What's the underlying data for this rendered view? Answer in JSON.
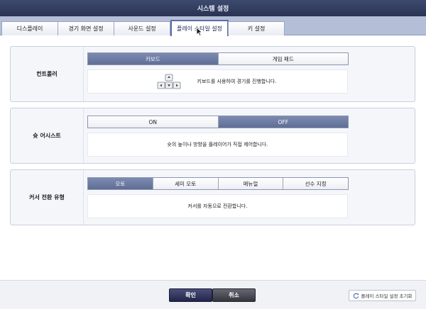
{
  "window": {
    "title": "시스템 설정"
  },
  "tabs": [
    {
      "label": "디스플레이"
    },
    {
      "label": "경기 화면 설정"
    },
    {
      "label": "사운드 설정"
    },
    {
      "label": "플레이 스타일 설정"
    },
    {
      "label": "키 설정"
    }
  ],
  "active_tab": "플레이 스타일 설정",
  "sections": {
    "controller": {
      "label": "컨트롤러",
      "options": [
        "키보드",
        "게임 패드"
      ],
      "selected": "키보드",
      "description": "키보드를 사용하여 경기를 진행합니다."
    },
    "shot_assist": {
      "label": "슛 어시스트",
      "options": [
        "ON",
        "OFF"
      ],
      "selected": "OFF",
      "description": "슛의 높이나 방향을 플레이어가 직접 제어합니다."
    },
    "cursor_switch": {
      "label": "커서 전환 유형",
      "options": [
        "오토",
        "세미 오토",
        "매뉴얼",
        "선수 지정"
      ],
      "selected": "오토",
      "description": "커서를 자동으로 전환합니다."
    }
  },
  "footer": {
    "ok_label": "확인",
    "cancel_label": "취소",
    "reset_label": "플레이 스타일 설정 초기화"
  },
  "colors": {
    "title_bar": "#2f3a5c",
    "tab_bar": "#b4bed6",
    "selected_option": "#6e7ca3",
    "ok_button": "#2e315a",
    "cancel_button": "#44464e"
  }
}
